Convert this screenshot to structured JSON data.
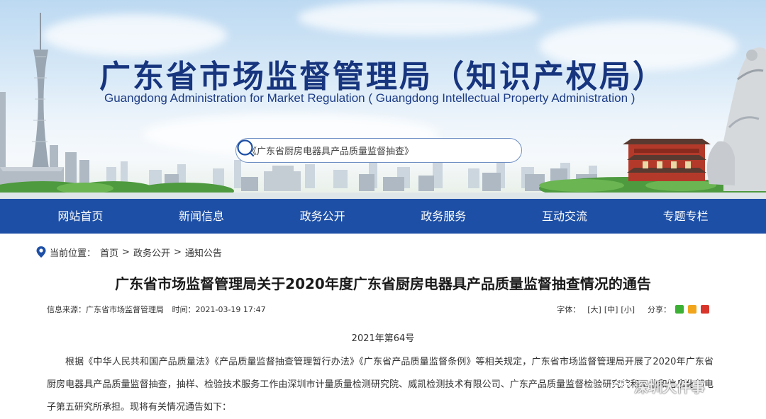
{
  "header": {
    "title": "广东省市场监督管理局（知识产权局）",
    "subtitle": "Guangdong Administration for Market Regulation ( Guangdong Intellectual Property Administration )",
    "search": {
      "value": "《广东省厨房电器具产品质量监督抽查》"
    }
  },
  "nav": {
    "items": [
      "网站首页",
      "新闻信息",
      "政务公开",
      "政务服务",
      "互动交流",
      "专题专栏"
    ]
  },
  "breadcrumb": {
    "label": "当前位置：",
    "items": [
      "首页",
      "政务公开",
      "通知公告"
    ],
    "separator": ">"
  },
  "article": {
    "title": "广东省市场监督管理局关于2020年度广东省厨房电器具产品质量监督抽查情况的通告",
    "meta": {
      "source": "信息来源：广东省市场监督管理局",
      "time": "时间：2021-03-19 17:47",
      "font_label": "字体：",
      "font_large": "[大]",
      "font_medium": "[中]",
      "font_small": "[小]",
      "share_label": "分享："
    },
    "doc_no": "2021年第64号",
    "body": "根据《中华人民共和国产品质量法》《产品质量监督抽查管理暂行办法》《广东省产品质量监督条例》等相关规定，广东省市场监督管理局开展了2020年广东省厨房电器具产品质量监督抽查，抽样、检验技术服务工作由深圳市计量质量检测研究院、威凯检测技术有限公司、广东产品质量监督检验研究院和工业和信息化部电子第五研究所承担。现将有关情况通告如下："
  },
  "watermark": {
    "text": "深圳大件事"
  },
  "colors": {
    "nav_bg": "#1d4fa6",
    "title_blue": "#17357e",
    "share_wechat": "#3cb034",
    "share_qzone": "#f0a51c",
    "share_weibo": "#d9352b"
  }
}
